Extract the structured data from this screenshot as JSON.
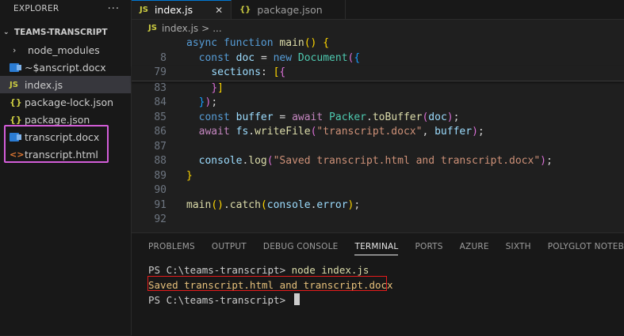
{
  "explorer": {
    "title": "EXPLORER",
    "more": "···",
    "project": "TEAMS-TRANSCRIPT",
    "items": [
      {
        "label": "node_modules",
        "icon": "chevron-right-icon"
      },
      {
        "label": "~$anscript.docx",
        "icon": "word-icon"
      },
      {
        "label": "index.js",
        "icon": "js-icon",
        "icon_text": "JS"
      },
      {
        "label": "package-lock.json",
        "icon": "json-icon",
        "icon_text": "{}"
      },
      {
        "label": "package.json",
        "icon": "json-icon",
        "icon_text": "{}"
      },
      {
        "label": "transcript.docx",
        "icon": "word-icon"
      },
      {
        "label": "transcript.html",
        "icon": "html-icon",
        "icon_text": "<>"
      }
    ]
  },
  "tabs": [
    {
      "label": "index.js",
      "icon_text": "JS",
      "close": "✕"
    },
    {
      "label": "package.json",
      "icon_text": "{}"
    }
  ],
  "breadcrumb": {
    "icon_text": "JS",
    "file": "index.js",
    "sep": ">",
    "rest": "..."
  },
  "code": [
    {
      "ln": "",
      "text": [
        "async function main() {"
      ]
    },
    {
      "ln": "8",
      "text": [
        "const doc = new Document({"
      ]
    },
    {
      "ln": "79",
      "text": [
        "sections: ["
      ]
    },
    {
      "ln": "83",
      "text": [
        "}]"
      ]
    },
    {
      "ln": "84",
      "text": [
        "});"
      ]
    },
    {
      "ln": "85",
      "text": [
        "const buffer = await Packer.toBuffer(doc);"
      ]
    },
    {
      "ln": "86",
      "text": [
        "await fs.writeFile(\"transcript.docx\", buffer);"
      ]
    },
    {
      "ln": "87",
      "text": [
        ""
      ]
    },
    {
      "ln": "88",
      "text": [
        "console.log(\"Saved transcript.html and transcript.docx\");"
      ]
    },
    {
      "ln": "89",
      "text": [
        "}"
      ]
    },
    {
      "ln": "90",
      "text": [
        ""
      ]
    },
    {
      "ln": "91",
      "text": [
        "main().catch(console.error);"
      ]
    },
    {
      "ln": "92",
      "text": [
        ""
      ]
    }
  ],
  "panel": {
    "tabs": [
      "PROBLEMS",
      "OUTPUT",
      "DEBUG CONSOLE",
      "TERMINAL",
      "PORTS",
      "AZURE",
      "SIXTH",
      "POLYGLOT NOTEBOOK"
    ],
    "active_tab": "TERMINAL",
    "terminal": {
      "prompt1": "PS C:\\teams-transcript> ",
      "cmd1": "node index.js",
      "output": "Saved transcript.html and transcript.docx",
      "prompt2": "PS C:\\teams-transcript> "
    }
  },
  "colors": {
    "highlight_magenta": "#d35dd8",
    "highlight_red": "#e51b1b",
    "accent": "#0078d4"
  }
}
